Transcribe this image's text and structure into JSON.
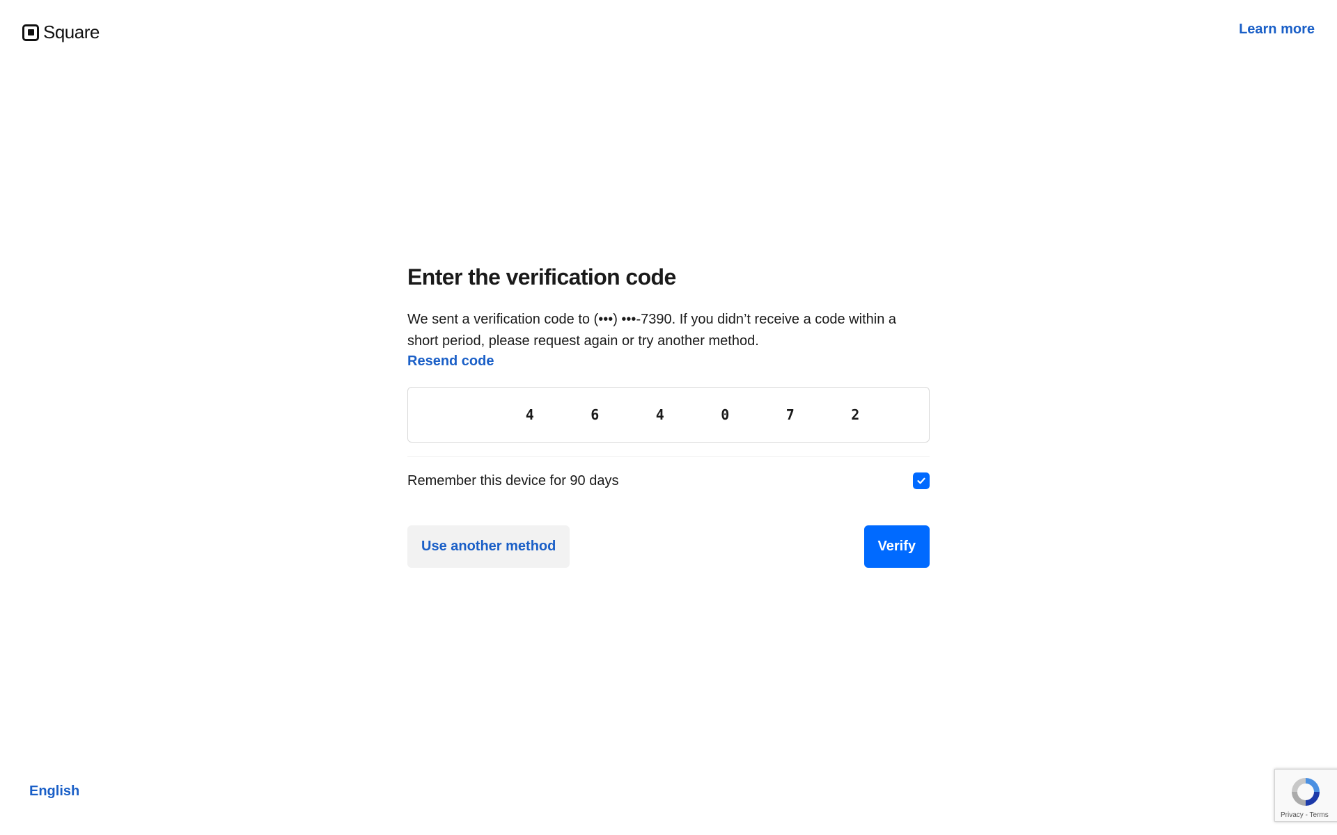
{
  "header": {
    "brand": "Square",
    "learn_more": "Learn more"
  },
  "main": {
    "title": "Enter the verification code",
    "description": "We sent a verification code to (•••) •••-7390. If you didn’t receive a code within a short period, please request again or try another method.",
    "resend_label": "Resend code",
    "code_digits": [
      "4",
      "6",
      "4",
      "0",
      "7",
      "2"
    ],
    "remember_label": "Remember this device for 90 days",
    "remember_checked": true,
    "secondary_button": "Use another method",
    "primary_button": "Verify"
  },
  "footer": {
    "language": "English",
    "recaptcha": {
      "privacy": "Privacy",
      "separator": " - ",
      "terms": "Terms"
    }
  },
  "colors": {
    "accent": "#006aff",
    "link": "#1a5fc7",
    "text": "#1a1a1a",
    "secondary_bg": "#f2f2f2"
  },
  "icons": [
    "square-logo-icon",
    "check-icon",
    "recaptcha-icon"
  ]
}
